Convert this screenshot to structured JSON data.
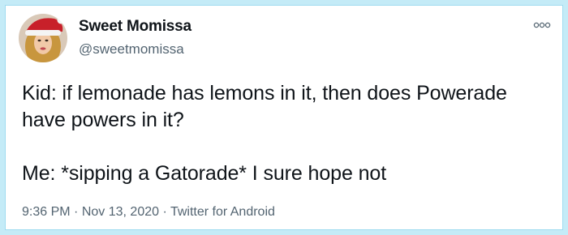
{
  "author": {
    "name": "Sweet Momissa",
    "handle": "@sweetmomissa"
  },
  "tweet": {
    "lines": [
      "Kid: if lemonade has lemons in it, then does Powerade",
      "have powers in it?",
      "Me: *sipping a Gatorade* I sure hope not"
    ]
  },
  "meta": {
    "time": "9:36 PM",
    "separator": "·",
    "date": "Nov 13, 2020",
    "source": "Twitter for Android"
  },
  "icons": {
    "more": "more-options-icon",
    "avatar": "profile-photo-santa-hat"
  },
  "colors": {
    "border": "#c4ebf7",
    "text": "#0f1419",
    "secondary": "#536471"
  }
}
